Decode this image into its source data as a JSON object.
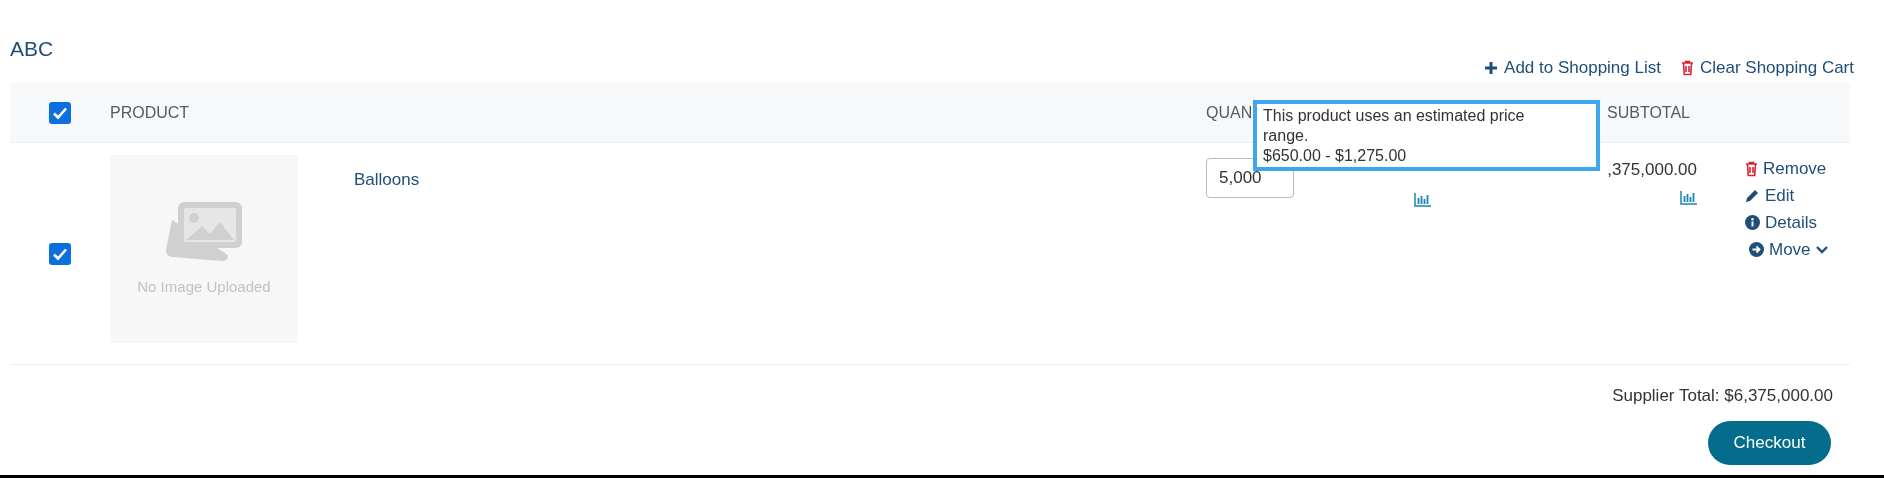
{
  "cart": {
    "title": "ABC",
    "actions": [
      {
        "kind": "add",
        "label": "Add to Shopping List"
      },
      {
        "kind": "clear",
        "label": "Clear Shopping Cart"
      }
    ],
    "select_all": {
      "checked": true
    },
    "columns": [
      "PRODUCT",
      "QUAN",
      "SUBTOTAL"
    ],
    "rows": [
      {
        "checked": true,
        "image_placeholder": "No Image Uploaded",
        "name": "Balloons",
        "quantity": "5,000",
        "subtotal": ",375,000.00",
        "actions": [
          {
            "kind": "remove",
            "label": "Remove"
          },
          {
            "kind": "edit",
            "label": "Edit"
          },
          {
            "kind": "details",
            "label": "Details"
          },
          {
            "kind": "move",
            "label": "Move"
          }
        ]
      }
    ],
    "tooltip": {
      "text": "This product uses an estimated price range.",
      "range": "$650.00 - $1,275.00"
    },
    "supplier_total": "Supplier Total: $6,375,000.00",
    "checkout": "Checkout"
  }
}
